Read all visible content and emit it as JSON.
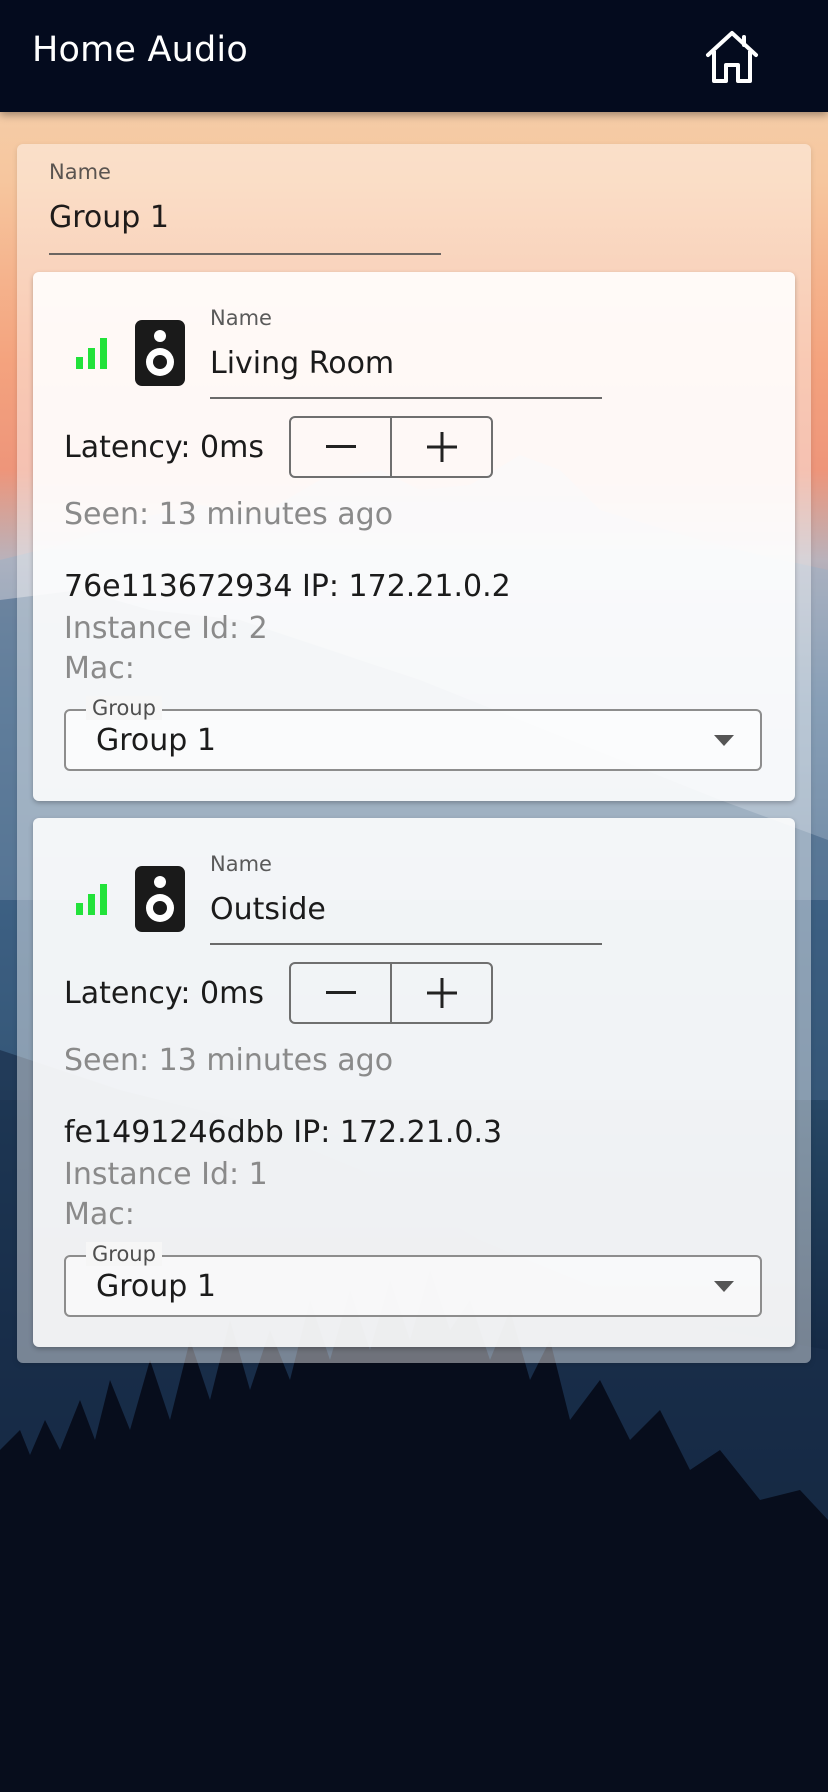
{
  "app_bar": {
    "title": "Home Audio",
    "home_icon": "home-icon"
  },
  "group": {
    "name_label": "Name",
    "name_value": "Group 1",
    "clients": [
      {
        "signal_icon": "signal-bars-icon",
        "signal_color": "#22e23a",
        "speaker_icon": "speaker-icon",
        "name_label": "Name",
        "name_value": "Living Room",
        "latency_text": "Latency: 0ms",
        "decrease_symbol": "−",
        "increase_symbol": "+",
        "seen_text": "Seen: 13 minutes ago",
        "device_text": "76e113672934 IP: 172.21.0.2",
        "instance_text": "Instance Id: 2",
        "mac_text": "Mac:",
        "group_select_label": "Group",
        "group_select_value": "Group 1"
      },
      {
        "signal_icon": "signal-bars-icon",
        "signal_color": "#22e23a",
        "speaker_icon": "speaker-icon",
        "name_label": "Name",
        "name_value": "Outside",
        "latency_text": "Latency: 0ms",
        "decrease_symbol": "−",
        "increase_symbol": "+",
        "seen_text": "Seen: 13 minutes ago",
        "device_text": "fe1491246dbb IP: 172.21.0.3",
        "instance_text": "Instance Id: 1",
        "mac_text": "Mac:",
        "group_select_label": "Group",
        "group_select_value": "Group 1"
      }
    ]
  }
}
